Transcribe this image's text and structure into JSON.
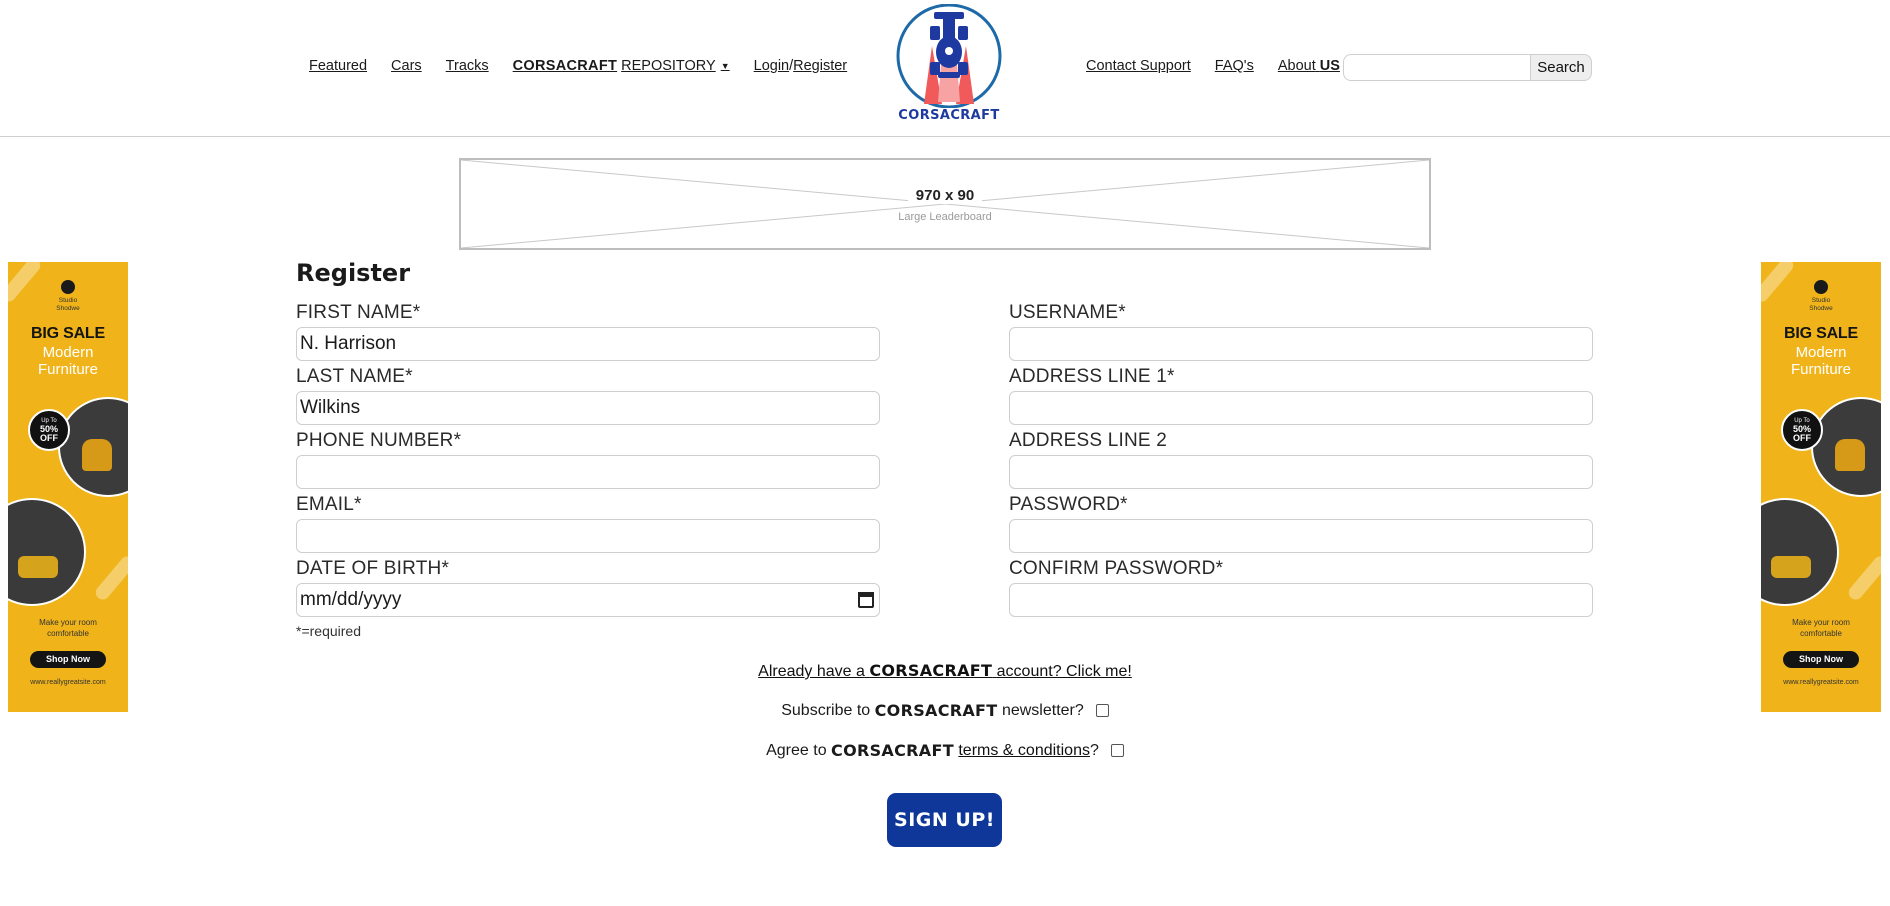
{
  "nav_left": {
    "featured": "Featured",
    "cars": "Cars",
    "tracks": "Tracks",
    "repository_brand": "CORSACRAFT",
    "repository_label": "REPOSITORY",
    "login": "Login",
    "separator": "/",
    "register": "Register"
  },
  "logo": {
    "text": "CORSACRAFT",
    "colors": {
      "ring": "#1e6aa8",
      "car": "#1e3aa0",
      "flame": "#f05a5a"
    }
  },
  "nav_right": {
    "contact": "Contact Support",
    "faq": "FAQ's",
    "about": "About",
    "us": "US"
  },
  "search": {
    "button": "Search",
    "placeholder": "",
    "value": ""
  },
  "leaderboard": {
    "size": "970 x 90",
    "name": "Large Leaderboard"
  },
  "side_ad": {
    "brand": "Studio Shodwe",
    "big_sale": "BIG SALE",
    "line1": "Modern",
    "line2": "Furniture",
    "badge_top": "Up To",
    "badge_value": "50%",
    "badge_off": "OFF",
    "tagline1": "Make your room",
    "tagline2": "comfortable",
    "cta": "Shop Now",
    "site": "www.reallygreatsite.com",
    "colors": {
      "background": "#f0b41a",
      "dark": "#141414"
    }
  },
  "form": {
    "title": "Register",
    "first_name": {
      "label": "FIRST NAME*",
      "value": "N. Harrison"
    },
    "last_name": {
      "label": "LAST NAME*",
      "value": "Wilkins"
    },
    "phone": {
      "label": "PHONE NUMBER*",
      "value": ""
    },
    "email": {
      "label": "EMAIL*",
      "value": ""
    },
    "dob": {
      "label": "DATE OF BIRTH*",
      "placeholder": "mm/dd/yyyy"
    },
    "username": {
      "label": "USERNAME*",
      "value": ""
    },
    "address1": {
      "label": "ADDRESS LINE 1*",
      "value": ""
    },
    "address2": {
      "label": "ADDRESS LINE 2",
      "value": ""
    },
    "password": {
      "label": "PASSWORD*",
      "value": ""
    },
    "confirm_password": {
      "label": "CONFIRM PASSWORD*",
      "value": ""
    },
    "required_note": "*=required"
  },
  "account": {
    "pre": "Already have a",
    "brand": "CORSACRAFT",
    "post": "account? Click me!"
  },
  "newsletter": {
    "pre": "Subscribe to",
    "brand": "CORSACRAFT",
    "post": "newsletter?",
    "checked": false
  },
  "terms": {
    "pre": "Agree to",
    "brand": "CORSACRAFT",
    "link": "terms & conditions",
    "post": "?",
    "checked": false
  },
  "signup": {
    "label": "SIGN UP!",
    "color": "#0f3699"
  }
}
